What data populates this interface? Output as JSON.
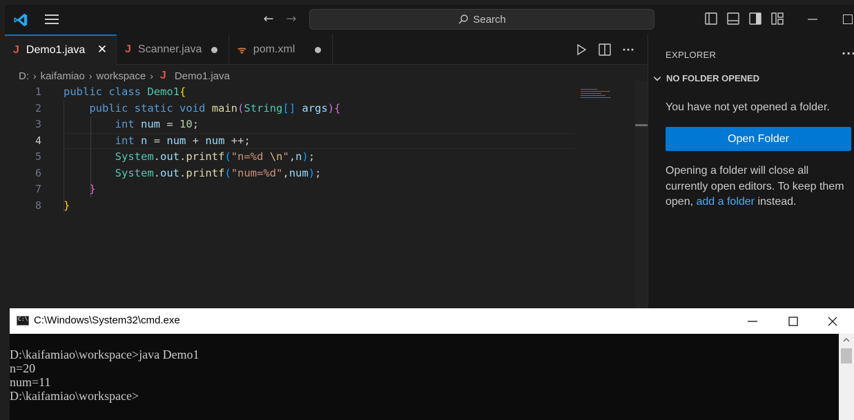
{
  "titlebar": {
    "search_placeholder": "Search",
    "back_glyph": "←",
    "forward_glyph": "→"
  },
  "tabs": [
    {
      "label": "Demo1.java",
      "icon": "java-icon",
      "active": true,
      "state": "close"
    },
    {
      "label": "Scanner.java",
      "icon": "java-icon",
      "active": false,
      "state": "modified"
    },
    {
      "label": "pom.xml",
      "icon": "rss-icon",
      "active": false,
      "state": "modified"
    }
  ],
  "breadcrumb": {
    "drive": "D:",
    "folder1": "kaifamiao",
    "folder2": "workspace",
    "file": "Demo1.java"
  },
  "editor": {
    "line_numbers": [
      "1",
      "2",
      "3",
      "4",
      "5",
      "6",
      "7",
      "8"
    ],
    "active_line": 4,
    "code": {
      "l1": {
        "kw1": "public",
        "kw2": "class",
        "cls": "Demo1",
        "br": "{"
      },
      "l2": {
        "kw1": "public",
        "kw2": "static",
        "kw3": "void",
        "fn": "main",
        "p1": "(",
        "cls": "String",
        "arr": "[]",
        "var": "args",
        "p2": ")",
        "br": "{"
      },
      "l3": {
        "kw": "int",
        "var": "num",
        "op": "=",
        "num": "10",
        "end": ";"
      },
      "l4": {
        "kw": "int",
        "var1": "n",
        "op1": "=",
        "var2": "num",
        "op2": "+",
        "var3": "num",
        "op3": "++",
        "end": ";"
      },
      "l5": {
        "cls": "System",
        "dot1": ".",
        "var": "out",
        "dot2": ".",
        "fn": "printf",
        "p1": "(",
        "str1": "\"n=%d ",
        "esc": "\\n",
        "str2": "\"",
        "comma": ",",
        "arg": "n",
        "p2": ")",
        "end": ";"
      },
      "l6": {
        "cls": "System",
        "dot1": ".",
        "var": "out",
        "dot2": ".",
        "fn": "printf",
        "p1": "(",
        "str": "\"num=%d\"",
        "comma": ",",
        "arg": "num",
        "p2": ")",
        "end": ";"
      },
      "l7": {
        "br": "}"
      },
      "l8": {
        "br": "}"
      }
    }
  },
  "explorer": {
    "title": "EXPLORER",
    "more": "···",
    "section": "NO FOLDER OPENED",
    "message": "You have not yet opened a folder.",
    "button": "Open Folder",
    "note_before": "Opening a folder will close all currently open editors. To keep them open, ",
    "note_link": "add a folder",
    "note_after": " instead."
  },
  "cmd": {
    "title": "C:\\Windows\\System32\\cmd.exe",
    "lines": [
      "D:\\kaifamiao\\workspace>java Demo1",
      "n=20",
      "num=11",
      "D:\\kaifamiao\\workspace>"
    ]
  },
  "colors": {
    "accent": "#0078d4",
    "link": "#4daafc",
    "java_icon": "#e05252"
  }
}
